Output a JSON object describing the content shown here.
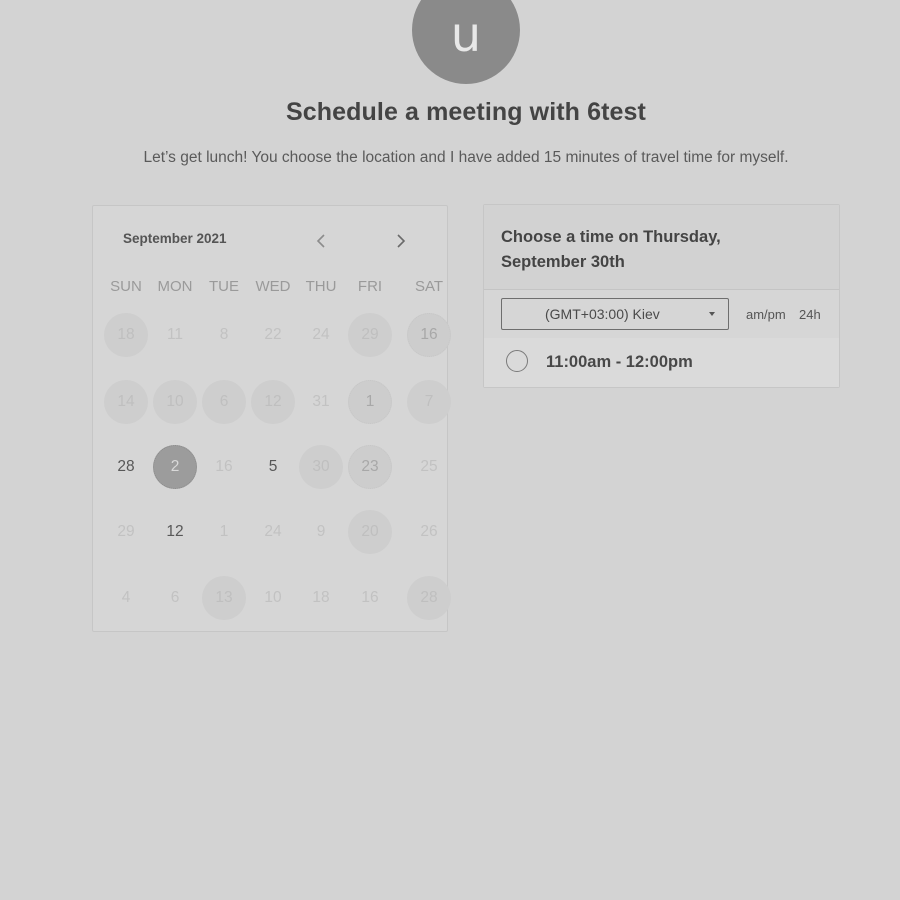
{
  "avatar": {
    "letter": "u"
  },
  "header": {
    "title": "Schedule a meeting with 6test",
    "subtitle": "Let’s get lunch! You choose the location and I have added 15 minutes of travel time for myself."
  },
  "calendar": {
    "month_label": "September 2021",
    "prev_icon": "chevron-left-icon",
    "next_icon": "chevron-right-icon",
    "weekdays": [
      "SUN",
      "MON",
      "TUE",
      "WED",
      "THU",
      "FRI",
      "SAT"
    ],
    "weeks": [
      [
        {
          "label": "18",
          "style": "circle"
        },
        {
          "label": "11",
          "style": "muted"
        },
        {
          "label": "8",
          "style": "muted"
        },
        {
          "label": "22",
          "style": "muted"
        },
        {
          "label": "24",
          "style": "muted"
        },
        {
          "label": "29",
          "style": "circle"
        },
        {
          "label": "16",
          "style": "circle-dot"
        }
      ],
      [
        {
          "label": "14",
          "style": "circle"
        },
        {
          "label": "10",
          "style": "circle"
        },
        {
          "label": "6",
          "style": "circle"
        },
        {
          "label": "12",
          "style": "circle"
        },
        {
          "label": "31",
          "style": "muted"
        },
        {
          "label": "1",
          "style": "circle-dot"
        },
        {
          "label": "7",
          "style": "circle"
        }
      ],
      [
        {
          "label": "28",
          "style": "normal"
        },
        {
          "label": "2",
          "style": "selected"
        },
        {
          "label": "16",
          "style": "muted"
        },
        {
          "label": "5",
          "style": "normal"
        },
        {
          "label": "30",
          "style": "circle"
        },
        {
          "label": "23",
          "style": "circle-dot"
        },
        {
          "label": "25",
          "style": "muted"
        }
      ],
      [
        {
          "label": "29",
          "style": "muted"
        },
        {
          "label": "12",
          "style": "normal"
        },
        {
          "label": "1",
          "style": "muted"
        },
        {
          "label": "24",
          "style": "muted"
        },
        {
          "label": "9",
          "style": "muted"
        },
        {
          "label": "20",
          "style": "circle"
        },
        {
          "label": "26",
          "style": "muted"
        }
      ],
      [
        {
          "label": "4",
          "style": "muted"
        },
        {
          "label": "6",
          "style": "muted"
        },
        {
          "label": "13",
          "style": "circle"
        },
        {
          "label": "10",
          "style": "muted"
        },
        {
          "label": "18",
          "style": "muted"
        },
        {
          "label": "16",
          "style": "muted"
        },
        {
          "label": "28",
          "style": "circle"
        }
      ]
    ]
  },
  "times": {
    "heading": "Choose a time on Thursday, September 30th",
    "timezone": "(GMT+03:00) Kiev",
    "format_ampm": "am/pm",
    "format_24h": "24h",
    "slots": [
      {
        "label": "11:00am - 12:00pm"
      }
    ]
  }
}
